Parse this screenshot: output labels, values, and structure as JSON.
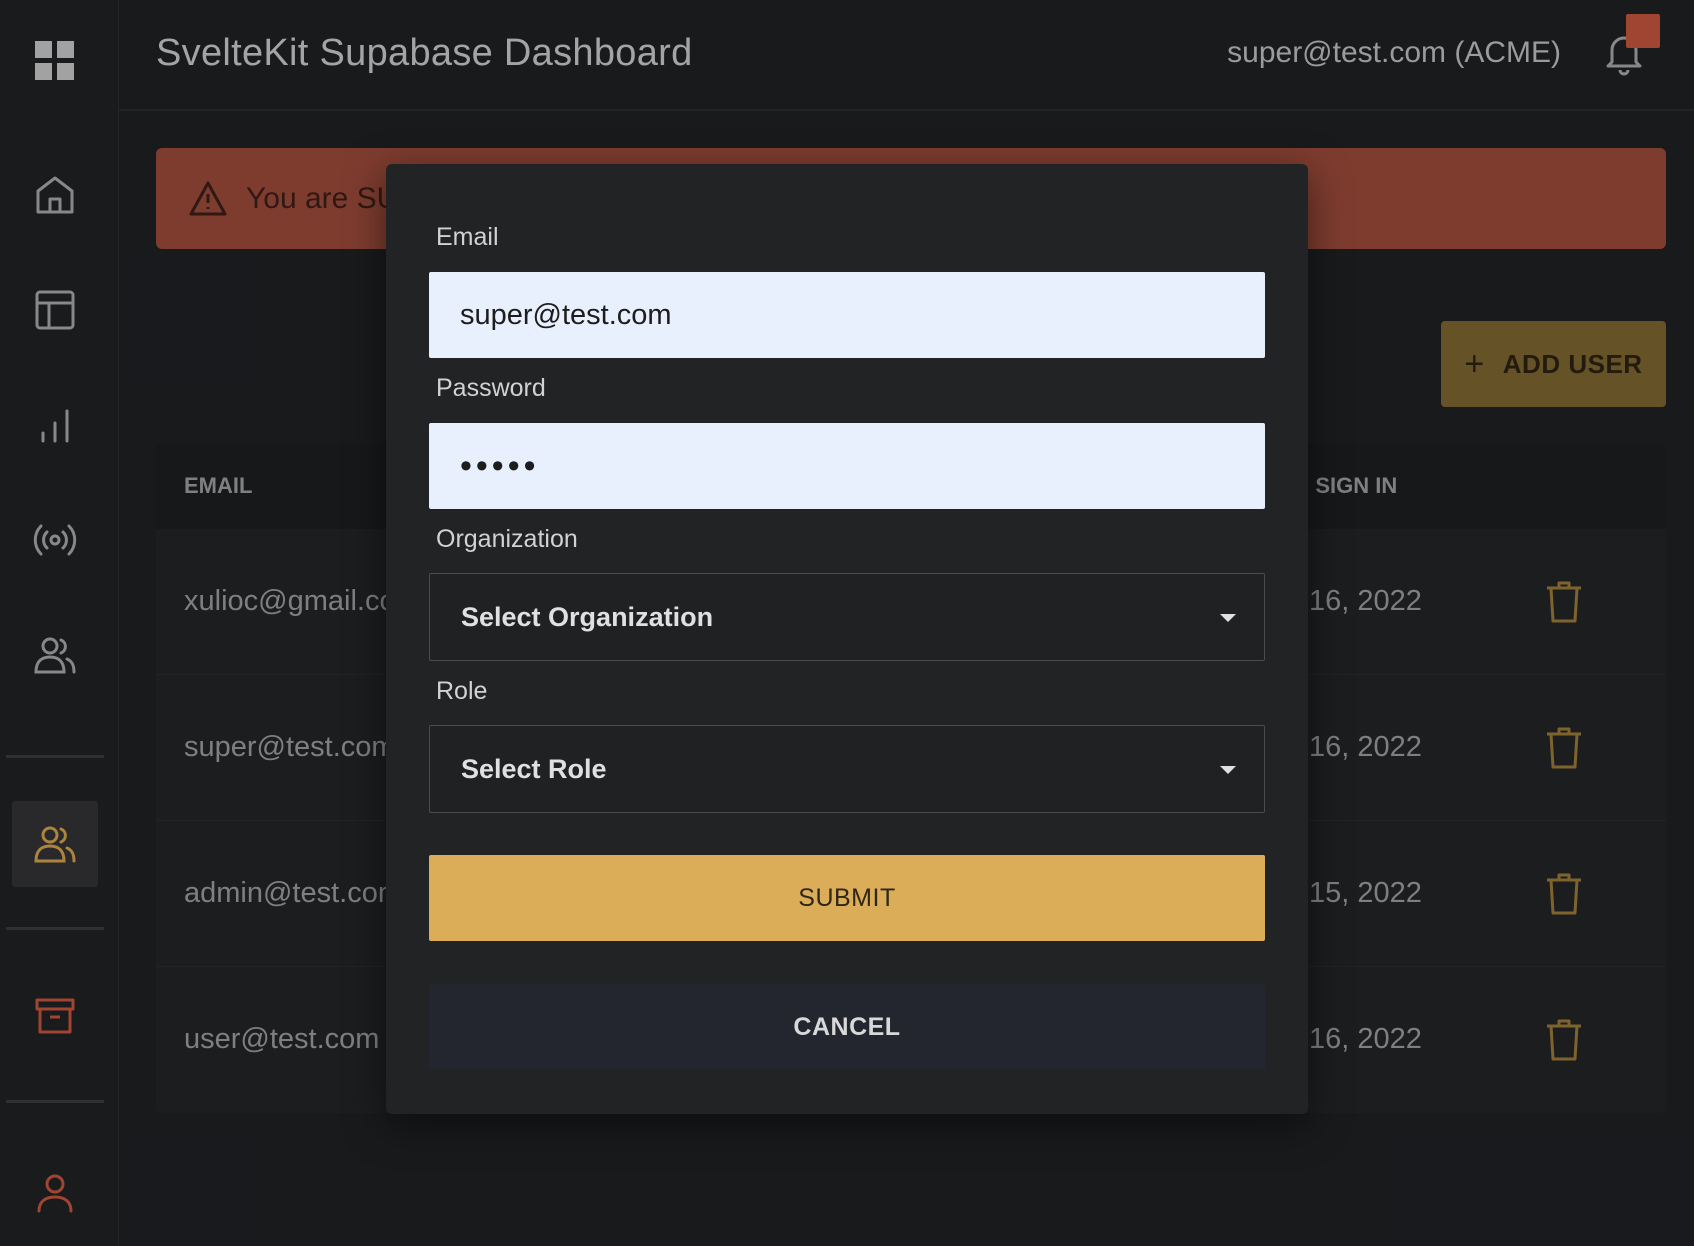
{
  "header": {
    "title": "SvelteKit Supabase Dashboard",
    "user": "super@test.com (ACME)"
  },
  "sidebar": {
    "items": [
      {
        "name": "apps-grid-icon"
      },
      {
        "name": "home-icon"
      },
      {
        "name": "layout-icon"
      },
      {
        "name": "chart-icon"
      },
      {
        "name": "broadcast-icon"
      },
      {
        "name": "users-icon"
      },
      {
        "name": "users-admin-icon",
        "active": true
      },
      {
        "name": "archive-icon"
      },
      {
        "name": "profile-icon"
      }
    ]
  },
  "alert": {
    "text": "You are SUP"
  },
  "toolbar": {
    "add_user_label": "ADD USER"
  },
  "table": {
    "headers": {
      "email": "EMAIL",
      "last_sign_in": "' SIGN IN"
    },
    "rows": [
      {
        "email": "xulioc@gmail.co",
        "last_sign_in": "16, 2022"
      },
      {
        "email": "super@test.com",
        "last_sign_in": "16, 2022"
      },
      {
        "email": "admin@test.com",
        "last_sign_in": "15, 2022"
      },
      {
        "email": "user@test.com",
        "last_sign_in": "16, 2022"
      }
    ]
  },
  "modal": {
    "email_label": "Email",
    "email_value": "super@test.com",
    "password_label": "Password",
    "password_value": "•••••",
    "organization_label": "Organization",
    "organization_selected": "Select Organization",
    "role_label": "Role",
    "role_selected": "Select Role",
    "submit_label": "SUBMIT",
    "cancel_label": "CANCEL"
  },
  "colors": {
    "accent": "#dbad58",
    "alert": "#9a4a3a",
    "badge": "#c4553e"
  }
}
